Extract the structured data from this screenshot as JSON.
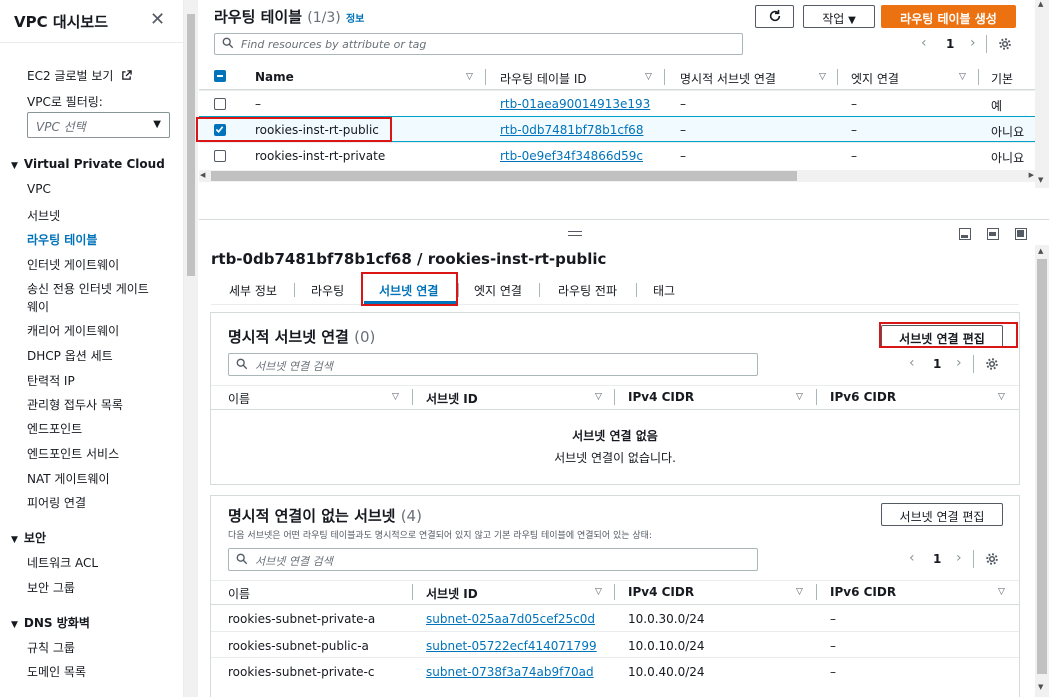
{
  "sidebar": {
    "title": "VPC 대시보드",
    "ec2_global_view": "EC2 글로벌 보기",
    "filter_label": "VPC로 필터링:",
    "vpc_select_placeholder": "VPC 선택",
    "section_vpc": "Virtual Private Cloud",
    "vpc_items": [
      "VPC",
      "서브넷",
      "라우팅 테이블",
      "인터넷 게이트웨이",
      "송신 전용 인터넷 게이트",
      "웨이",
      "캐리어 게이트웨이",
      "DHCP 옵션 세트",
      "탄력적 IP",
      "관리형 접두사 목록",
      "엔드포인트",
      "엔드포인트 서비스",
      "NAT 게이트웨이",
      "피어링 연결"
    ],
    "section_security": "보안",
    "security_items": [
      "네트워크 ACL",
      "보안 그룹"
    ],
    "section_dns": "DNS 방화벽",
    "dns_items": [
      "규칙 그룹",
      "도메인 목록"
    ]
  },
  "route_tables": {
    "title": "라우팅 테이블",
    "count": "(1/3)",
    "info": "정보",
    "actions_label": "작업",
    "create_label": "라우팅 테이블 생성",
    "search_placeholder": "Find resources by attribute or tag",
    "page": "1",
    "columns": [
      "Name",
      "라우팅 테이블 ID",
      "명시적 서브넷 연결",
      "엣지 연결",
      "기본"
    ],
    "rows": [
      {
        "name": "–",
        "id": "rtb-01aea90014913e193",
        "explicit": "–",
        "edge": "–",
        "main": "예",
        "checked": false
      },
      {
        "name": "rookies-inst-rt-public",
        "id": "rtb-0db7481bf78b1cf68",
        "explicit": "–",
        "edge": "–",
        "main": "아니요",
        "checked": true
      },
      {
        "name": "rookies-inst-rt-private",
        "id": "rtb-0e9ef34f34866d59c",
        "explicit": "–",
        "edge": "–",
        "main": "아니요",
        "checked": false
      }
    ]
  },
  "detail": {
    "title": "rtb-0db7481bf78b1cf68 / rookies-inst-rt-public",
    "tabs": [
      "세부 정보",
      "라우팅",
      "서브넷 연결",
      "엣지 연결",
      "라우팅 전파",
      "태그"
    ],
    "active_tab": "서브넷 연결",
    "explicit": {
      "title": "명시적 서브넷 연결",
      "count": "(0)",
      "edit_label": "서브넷 연결 편집",
      "search_placeholder": "서브넷 연결 검색",
      "page": "1",
      "columns": [
        "이름",
        "서브넷 ID",
        "IPv4 CIDR",
        "IPv6 CIDR"
      ],
      "empty_title": "서브넷 연결 없음",
      "empty_desc": "서브넷 연결이 없습니다."
    },
    "implicit": {
      "title": "명시적 연결이 없는 서브넷",
      "count": "(4)",
      "description": "다음 서브넷은 어떤 라우팅 테이블과도 명시적으로 연결되어 있지 않고 기본 라우팅 테이블에 연결되어 있는 상태:",
      "edit_label": "서브넷 연결 편집",
      "search_placeholder": "서브넷 연결 검색",
      "page": "1",
      "columns": [
        "이름",
        "서브넷 ID",
        "IPv4 CIDR",
        "IPv6 CIDR"
      ],
      "rows": [
        {
          "name": "rookies-subnet-private-a",
          "id": "subnet-025aa7d05cef25c0d",
          "ipv4": "10.0.30.0/24",
          "ipv6": "–"
        },
        {
          "name": "rookies-subnet-public-a",
          "id": "subnet-05722ecf414071799",
          "ipv4": "10.0.10.0/24",
          "ipv6": "–"
        },
        {
          "name": "rookies-subnet-private-c",
          "id": "subnet-0738f3a74ab9f70ad",
          "ipv4": "10.0.40.0/24",
          "ipv6": "–"
        }
      ]
    }
  },
  "colors": {
    "accent": "#0073bb",
    "primary": "#ec7211",
    "highlight": "#d91515",
    "selected_row": "#f1faff"
  }
}
